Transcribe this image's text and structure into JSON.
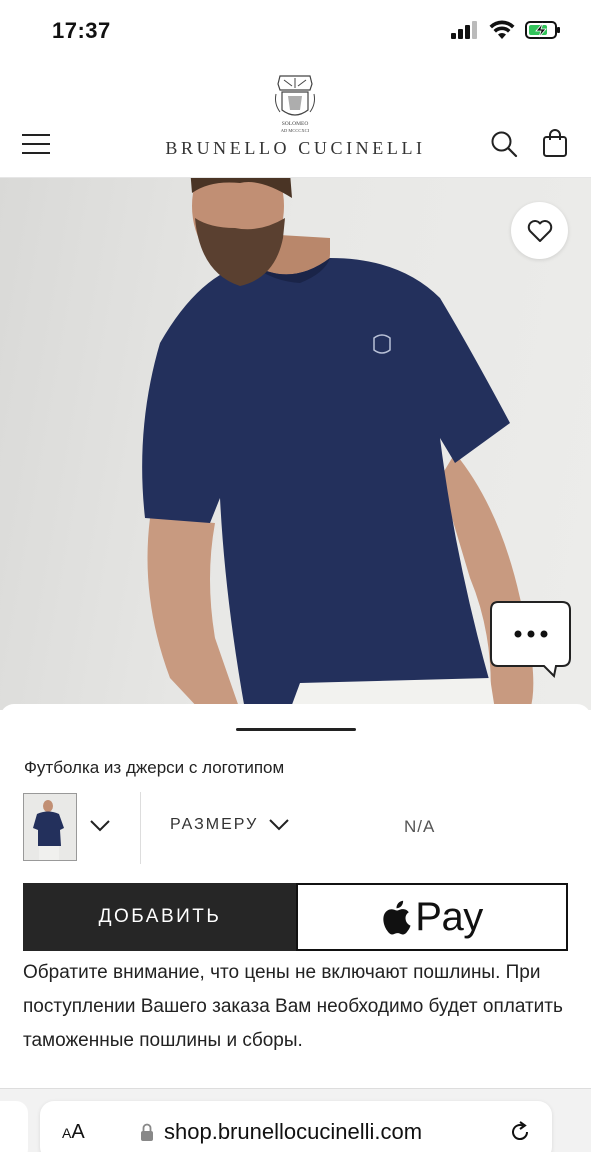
{
  "status_bar": {
    "time": "17:37"
  },
  "header": {
    "brand": "BRUNELLO CUCINELLI",
    "emblem_text_1": "SOLOMEO",
    "emblem_text_2": "AD MCCCXCI"
  },
  "product": {
    "title": "Футболка из джерси с логотипом",
    "size_label": "РАЗМЕРУ",
    "size_value": "N/A",
    "add_button": "ДОБАВИТЬ",
    "apple_pay_label": "Pay",
    "notice": "Обратите внимание, что цены не включают пошлины. При поступлении Вашего заказа Вам необходимо будет оплатить таможенные пошлины и сборы."
  },
  "browser": {
    "aa_label_small": "A",
    "aa_label_big": "A",
    "url": "shop.brunellocucinelli.com"
  },
  "colors": {
    "shirt": "#23305c",
    "button_dark": "#262626",
    "background": "#ffffff"
  }
}
